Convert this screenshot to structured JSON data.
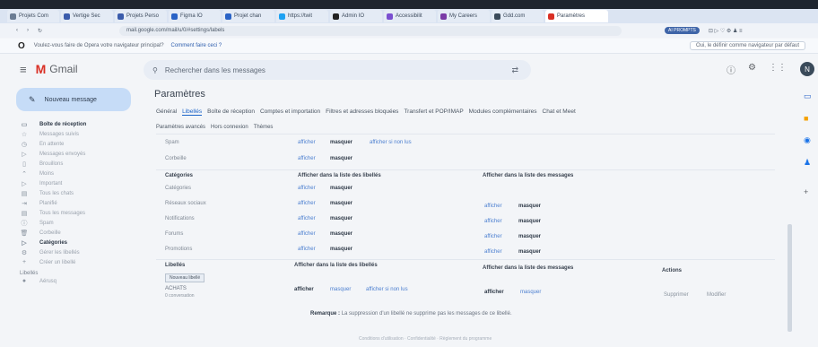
{
  "browser": {
    "tabs": [
      {
        "label": "Projets Com",
        "color": "#6b7c93"
      },
      {
        "label": "Vertige Sec",
        "color": "#3b5cab"
      },
      {
        "label": "Projets Perso",
        "color": "#3b5cab"
      },
      {
        "label": "Figma IO",
        "color": "#2a63c6"
      },
      {
        "label": "Projet chan",
        "color": "#2a63c6"
      },
      {
        "label": "https://twit",
        "color": "#1da1f2"
      },
      {
        "label": "Admin IO",
        "color": "#222222"
      },
      {
        "label": "Accessibilit",
        "color": "#7a4fd0"
      },
      {
        "label": "My Careers",
        "color": "#7a3aa6"
      },
      {
        "label": "Gdd.com",
        "color": "#3a4a5a"
      },
      {
        "label": "Paramètres",
        "color": "#d93025"
      }
    ],
    "url": "mail.google.com/mail/u/0/#settings/labels",
    "prompts_pill": "AI PROMPTS",
    "infobar_question": "Voulez-vous faire de Opera votre navigateur principal?",
    "infobar_link": "Comment faire ceci ?",
    "infobar_button": "Oui, le définir comme navigateur par défaut"
  },
  "app": {
    "name": "Gmail",
    "search_placeholder": "Rechercher dans les messages",
    "avatar_letter": "N",
    "compose_label": "Nouveau message"
  },
  "sidebar": {
    "items": [
      {
        "label": "Boîte de réception",
        "icon": "inbox-icon",
        "glyph": "▭",
        "bold": true
      },
      {
        "label": "Messages suivis",
        "icon": "star-icon",
        "glyph": "☆",
        "bold": false
      },
      {
        "label": "En attente",
        "icon": "clock-icon",
        "glyph": "◷",
        "bold": false
      },
      {
        "label": "Messages envoyés",
        "icon": "send-icon",
        "glyph": "▷",
        "bold": false
      },
      {
        "label": "Brouillons",
        "icon": "draft-icon",
        "glyph": "▯",
        "bold": false
      },
      {
        "label": "Moins",
        "icon": "chevron-up-icon",
        "glyph": "⌃",
        "bold": false
      },
      {
        "label": "Important",
        "icon": "important-icon",
        "glyph": "▷",
        "bold": false
      },
      {
        "label": "Tous les chats",
        "icon": "chat-icon",
        "glyph": "▤",
        "bold": false
      },
      {
        "label": "Planifié",
        "icon": "schedule-icon",
        "glyph": "⇥",
        "bold": false
      },
      {
        "label": "Tous les messages",
        "icon": "all-mail-icon",
        "glyph": "▤",
        "bold": false
      },
      {
        "label": "Spam",
        "icon": "spam-icon",
        "glyph": "ⓘ",
        "bold": false
      },
      {
        "label": "Corbeille",
        "icon": "trash-icon",
        "glyph": "🗑",
        "bold": false
      },
      {
        "label": "Catégories",
        "icon": "category-icon",
        "glyph": "▷",
        "bold": true
      },
      {
        "label": "Gérer les libellés",
        "icon": "settings-icon",
        "glyph": "⚙",
        "bold": false
      },
      {
        "label": "Créer un libellé",
        "icon": "plus-icon",
        "glyph": "+",
        "bold": false
      }
    ],
    "labels_section": "Libellés",
    "labels_first": "Aérusq"
  },
  "settings": {
    "title": "Paramètres",
    "tabs": [
      "Général",
      "Libellés",
      "Boîte de réception",
      "Comptes et importation",
      "Filtres et adresses bloquées",
      "Transfert et POP/IMAP",
      "Modules complémentaires",
      "Chat et Meet"
    ],
    "active_tab": 1,
    "subtabs": [
      "Paramètres avancés",
      "Hors connexion",
      "Thèmes"
    ],
    "system_rows": [
      {
        "name": "Spam",
        "show": "afficher",
        "hide": "masquer",
        "extra": "afficher si non lus"
      },
      {
        "name": "Corbeille",
        "show": "afficher",
        "hide": "masquer",
        "extra": ""
      }
    ],
    "categories_header": "Catégories",
    "header_labels_list": "Afficher dans la liste des libellés",
    "header_messages_list": "Afficher dans la liste des messages",
    "category_rows": [
      {
        "name": "Catégories",
        "show": "afficher",
        "hide": "masquer",
        "mshow": "",
        "mhide": ""
      },
      {
        "name": "Réseaux sociaux",
        "show": "afficher",
        "hide": "masquer",
        "mshow": "afficher",
        "mhide": "masquer"
      },
      {
        "name": "Notifications",
        "show": "afficher",
        "hide": "masquer",
        "mshow": "afficher",
        "mhide": "masquer"
      },
      {
        "name": "Forums",
        "show": "afficher",
        "hide": "masquer",
        "mshow": "afficher",
        "mhide": "masquer"
      },
      {
        "name": "Promotions",
        "show": "afficher",
        "hide": "masquer",
        "mshow": "afficher",
        "mhide": "masquer"
      }
    ],
    "labels_header": "Libellés",
    "new_label_button": "Nouveau libellé",
    "actions_header": "Actions",
    "label_row": {
      "name": "ACHATS",
      "sub": "0 conversation",
      "show": "afficher",
      "hide": "masquer",
      "extra": "afficher si non lus",
      "mshow": "afficher",
      "mhide": "masquer",
      "remove": "Supprimer",
      "edit": "Modifier"
    },
    "note_bold": "Remarque :",
    "note_text": "La suppression d'un libellé ne supprime pas les messages de ce libellé.",
    "footer": "Conditions d'utilisation · Confidentialité · Règlement du programme"
  }
}
